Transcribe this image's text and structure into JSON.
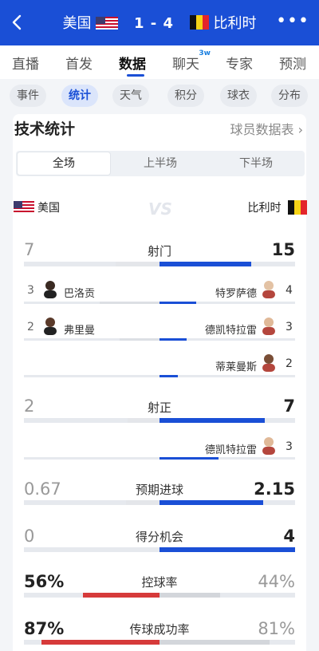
{
  "header": {
    "home_team": "美国",
    "score": "1 - 4",
    "away_team": "比利时",
    "more_icon": "•••"
  },
  "tabs": [
    {
      "label": "直播"
    },
    {
      "label": "首发"
    },
    {
      "label": "数据",
      "active": true
    },
    {
      "label": "聊天",
      "badge": "3w"
    },
    {
      "label": "专家"
    },
    {
      "label": "预测"
    }
  ],
  "subtabs": [
    {
      "label": "事件"
    },
    {
      "label": "统计",
      "active": true
    },
    {
      "label": "天气"
    },
    {
      "label": "积分"
    },
    {
      "label": "球衣"
    },
    {
      "label": "分布"
    }
  ],
  "section": {
    "title": "技术统计",
    "player_link": "球员数据表 ›"
  },
  "periods": [
    "全场",
    "上半场",
    "下半场"
  ],
  "teams": {
    "left": "美国",
    "right": "比利时",
    "vs": "VS"
  },
  "colors": {
    "home": "#1a4fd6",
    "away": "#d63a3a",
    "accent": "#1a4fd6"
  },
  "stats": {
    "shots": {
      "label": "射门",
      "left": "7",
      "right": "15",
      "home_pct": 0.32
    },
    "shots_players": [
      {
        "left_num": "3",
        "left_name": "巴洛贡",
        "right_name": "特罗萨德",
        "right_num": "4",
        "left_fill": 0.43,
        "right_fill": 0.27
      },
      {
        "left_num": "2",
        "left_name": "弗里曼",
        "right_name": "德凯特拉雷",
        "right_num": "3",
        "left_fill": 0.29,
        "right_fill": 0.2
      },
      {
        "left_num": "",
        "left_name": "",
        "right_name": "蒂莱曼斯",
        "right_num": "2",
        "left_fill": 0,
        "right_fill": 0.13
      }
    ],
    "on_target": {
      "label": "射正",
      "left": "2",
      "right": "7",
      "home_pct": 0.22
    },
    "on_target_players": [
      {
        "left_num": "",
        "left_name": "",
        "right_name": "德凯特拉雷",
        "right_num": "3",
        "left_fill": 0,
        "right_fill": 0.43
      }
    ],
    "xg": {
      "label": "预期进球",
      "left": "0.67",
      "right": "2.15",
      "home_pct": 0.24
    },
    "chances": {
      "label": "得分机会",
      "left": "0",
      "right": "4",
      "home_pct": 0.0
    },
    "possession": {
      "label": "控球率",
      "left": "56%",
      "right": "44%",
      "home_pct": 0.56
    },
    "pass_acc": {
      "label": "传球成功率",
      "left": "87%",
      "right": "81%",
      "home_pct": 0.52
    }
  }
}
